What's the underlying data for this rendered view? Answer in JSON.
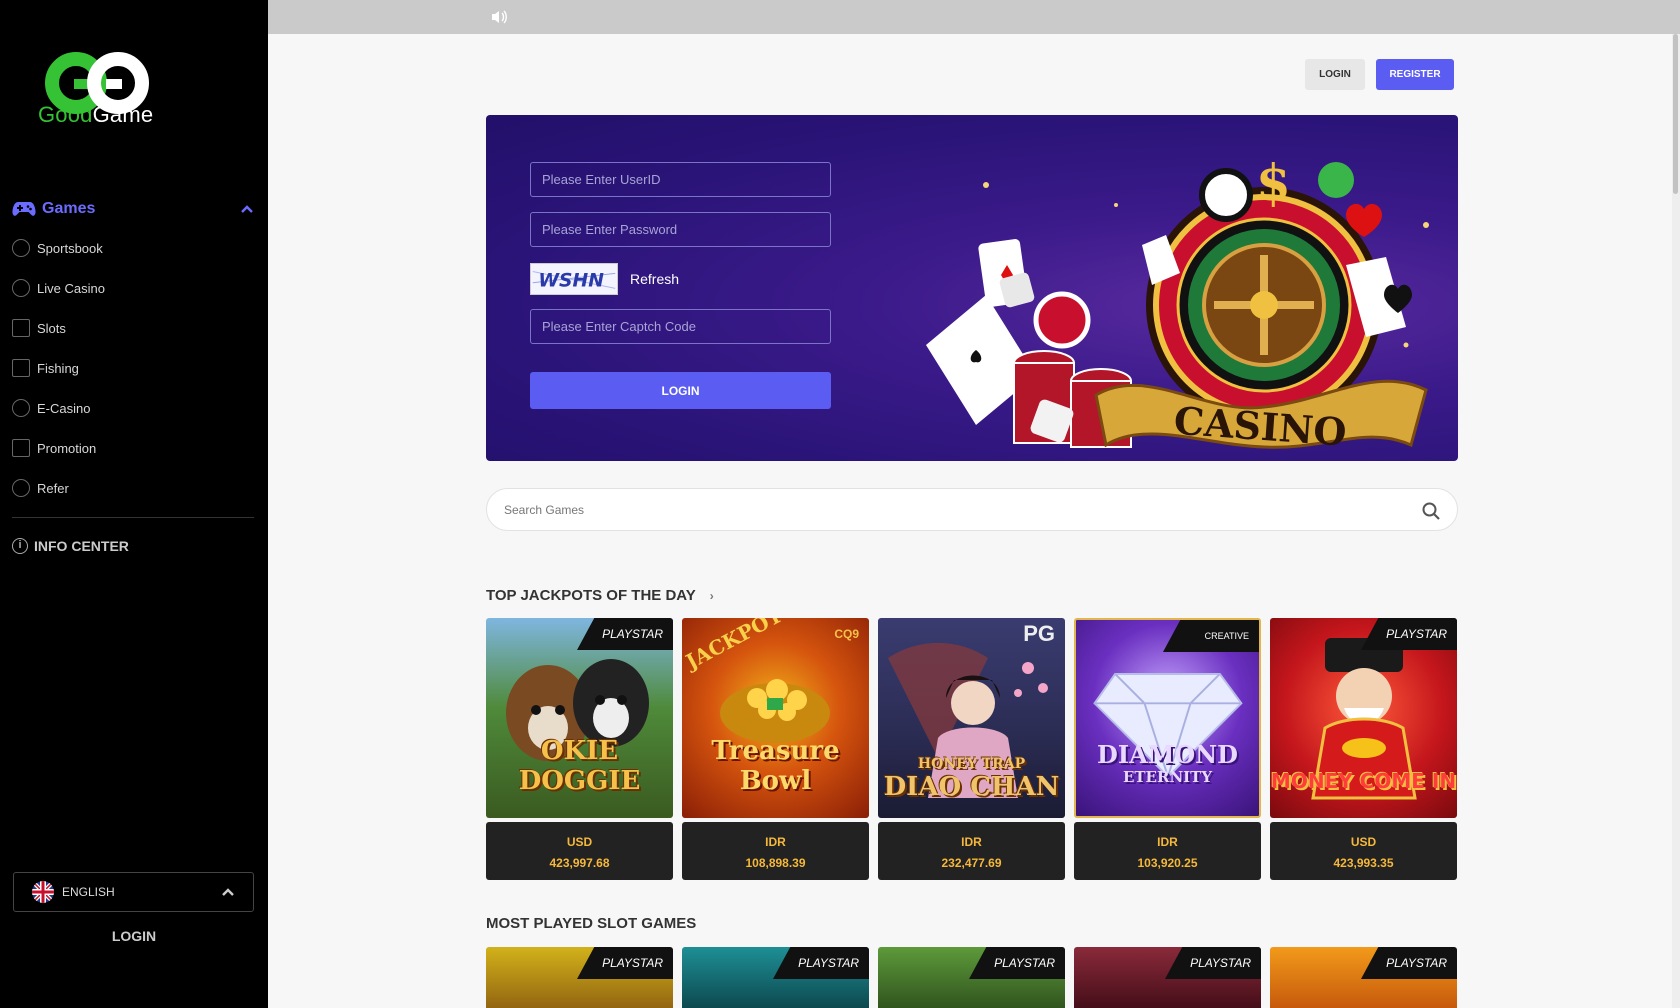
{
  "brand": {
    "name_part1": "Good",
    "name_part2": "Game"
  },
  "sidebar": {
    "games_label": "Games",
    "items": [
      {
        "label": "Sportsbook",
        "icon": "soccer-ball-icon"
      },
      {
        "label": "Live Casino",
        "icon": "dealer-icon"
      },
      {
        "label": "Slots",
        "icon": "slot-machine-icon"
      },
      {
        "label": "Fishing",
        "icon": "fish-icon"
      },
      {
        "label": "E-Casino",
        "icon": "joystick-icon"
      },
      {
        "label": "Promotion",
        "icon": "gift-icon"
      },
      {
        "label": "Refer",
        "icon": "handshake-icon"
      }
    ],
    "info_center": "INFO CENTER",
    "language": "ENGLISH",
    "login": "LOGIN"
  },
  "header": {
    "login": "LOGIN",
    "register": "REGISTER"
  },
  "hero": {
    "userid_placeholder": "Please Enter UserID",
    "password_placeholder": "Please Enter Password",
    "captcha_text": "WSHN",
    "refresh": "Refresh",
    "captcha_placeholder": "Please Enter Captch Code",
    "login_button": "LOGIN",
    "art_label": "CASINO"
  },
  "search": {
    "placeholder": "Search Games"
  },
  "top_jackpots": {
    "title": "TOP JACKPOTS OF THE DAY",
    "games": [
      {
        "provider": "PLAYSTAR",
        "title_line1": "OKIE",
        "title_line2": "DOGGIE",
        "currency": "USD",
        "amount": "423,997.68",
        "bg": "#3f6a2a"
      },
      {
        "provider": "CQ9",
        "title_line1": "Treasure",
        "title_line2": "Bowl",
        "currency": "IDR",
        "amount": "108,898.39",
        "bg": "#a8340c"
      },
      {
        "provider": "PG",
        "title_line1": "HONEY TRAP",
        "title_line2": "DIAO CHAN",
        "currency": "IDR",
        "amount": "232,477.69",
        "bg": "#2c2d55"
      },
      {
        "provider": "CREATIVE",
        "title_line1": "DIAMOND",
        "title_line2": "ETERNITY",
        "currency": "IDR",
        "amount": "103,920.25",
        "bg": "#5a26a8"
      },
      {
        "provider": "PLAYSTAR",
        "title_line1": "",
        "title_line2": "MONEY COME IN",
        "currency": "USD",
        "amount": "423,993.35",
        "bg": "#c4161c"
      }
    ]
  },
  "most_played": {
    "title": "MOST PLAYED SLOT GAMES",
    "games": [
      {
        "provider": "PLAYSTAR",
        "bg": "#c19012"
      },
      {
        "provider": "PLAYSTAR",
        "bg": "#0f6d74"
      },
      {
        "provider": "PLAYSTAR",
        "bg": "#3b6e2a"
      },
      {
        "provider": "PLAYSTAR",
        "bg": "#6a1c2a"
      },
      {
        "provider": "PLAYSTAR",
        "bg": "#e07a12"
      }
    ]
  },
  "colors": {
    "accent": "#5b5cf2",
    "brand_green": "#35c234",
    "jackpot": "#f6b83a"
  }
}
